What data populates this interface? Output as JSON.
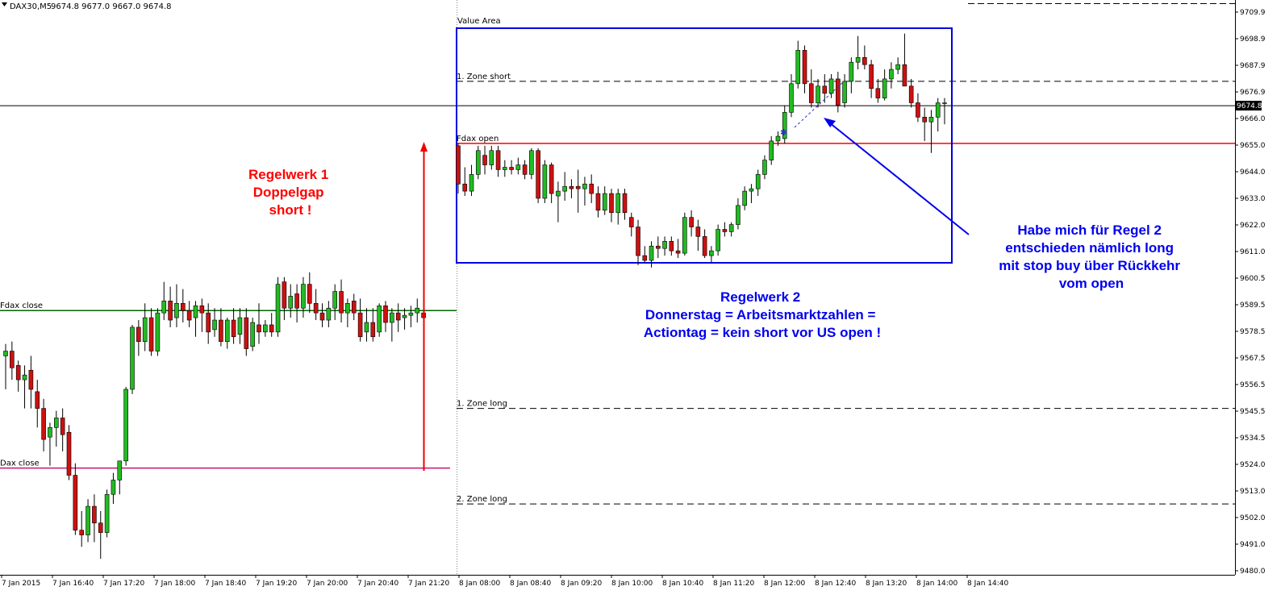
{
  "header": {
    "symbol": "DAX30,M5",
    "ohlc": "9674.8 9677.0 9667.0 9674.8"
  },
  "colors": {
    "bull_body": "#22bb22",
    "bear_body": "#cc1111",
    "wick": "#000000",
    "fdax_close_line": "#006600",
    "dax_close_line": "#cc1177",
    "fdax_open_line": "#ff0000",
    "value_area_box": "#0000dd",
    "annotation_red": "#ff0000",
    "annotation_blue": "#0000ee"
  },
  "chart_data": {
    "type": "candlestick",
    "ylim": [
      9480,
      9714
    ],
    "y_ticks": [
      "9709.9",
      "9698.9",
      "9687.9",
      "9676.9",
      "9666.0",
      "9655.0",
      "9644.0",
      "9633.0",
      "9622.0",
      "9611.0",
      "9600.5",
      "9589.5",
      "9578.5",
      "9567.5",
      "9556.5",
      "9545.5",
      "9534.5",
      "9524.0",
      "9513.0",
      "9502.0",
      "9491.0",
      "9480.0"
    ],
    "x_ticks": [
      "7 Jan 2015",
      "7 Jan 16:40",
      "7 Jan 17:20",
      "7 Jan 18:00",
      "7 Jan 18:40",
      "7 Jan 19:20",
      "7 Jan 20:00",
      "7 Jan 20:40",
      "7 Jan 21:20",
      "8 Jan 08:00",
      "8 Jan 08:40",
      "8 Jan 09:20",
      "8 Jan 10:00",
      "8 Jan 10:40",
      "8 Jan 11:20",
      "8 Jan 12:00",
      "8 Jan 12:40",
      "8 Jan 13:20",
      "8 Jan 14:00",
      "8 Jan 14:40"
    ],
    "current_price": "9674.8",
    "session1_ohlc": [
      [
        9570,
        9575,
        9556,
        9572
      ],
      [
        9572,
        9576,
        9560,
        9565
      ],
      [
        9566,
        9568,
        9555,
        9560
      ],
      [
        9560,
        9566,
        9548,
        9562
      ],
      [
        9564,
        9570,
        9548,
        9556
      ],
      [
        9555,
        9560,
        9540,
        9548
      ],
      [
        9548,
        9552,
        9530,
        9535
      ],
      [
        9536,
        9542,
        9524,
        9540
      ],
      [
        9540,
        9547,
        9532,
        9544
      ],
      [
        9544,
        9548,
        9530,
        9537
      ],
      [
        9538,
        9541,
        9518,
        9520
      ],
      [
        9520,
        9525,
        9495,
        9497
      ],
      [
        9497,
        9505,
        9490,
        9495
      ],
      [
        9495,
        9510,
        9492,
        9507
      ],
      [
        9507,
        9512,
        9492,
        9500
      ],
      [
        9500,
        9505,
        9485,
        9496
      ],
      [
        9496,
        9514,
        9494,
        9512
      ],
      [
        9512,
        9521,
        9508,
        9518
      ],
      [
        9518,
        9526,
        9512,
        9526
      ],
      [
        9526,
        9557,
        9524,
        9556
      ],
      [
        9556,
        9583,
        9554,
        9582
      ],
      [
        9582,
        9585,
        9570,
        9576
      ],
      [
        9576,
        9592,
        9572,
        9586
      ],
      [
        9586,
        9590,
        9570,
        9572
      ],
      [
        9572,
        9590,
        9570,
        9588
      ],
      [
        9588,
        9601,
        9585,
        9593
      ],
      [
        9593,
        9599,
        9582,
        9585
      ],
      [
        9586,
        9600,
        9582,
        9592
      ],
      [
        9592,
        9598,
        9584,
        9589
      ],
      [
        9589,
        9593,
        9582,
        9585
      ],
      [
        9586,
        9593,
        9578,
        9591
      ],
      [
        9591,
        9594,
        9580,
        9588
      ],
      [
        9588,
        9592,
        9575,
        9580
      ],
      [
        9581,
        9590,
        9578,
        9585
      ],
      [
        9585,
        9590,
        9574,
        9576
      ],
      [
        9576,
        9586,
        9573,
        9585
      ],
      [
        9585,
        9590,
        9575,
        9578
      ],
      [
        9579,
        9590,
        9575,
        9586
      ],
      [
        9586,
        9590,
        9570,
        9573
      ],
      [
        9574,
        9586,
        9572,
        9584
      ],
      [
        9583,
        9592,
        9575,
        9580
      ],
      [
        9580,
        9585,
        9578,
        9583
      ],
      [
        9583,
        9588,
        9578,
        9580
      ],
      [
        9580,
        9603,
        9578,
        9600
      ],
      [
        9601,
        9603,
        9585,
        9590
      ],
      [
        9590,
        9600,
        9586,
        9595
      ],
      [
        9596,
        9600,
        9584,
        9590
      ],
      [
        9590,
        9603,
        9586,
        9600
      ],
      [
        9600,
        9605,
        9588,
        9592
      ],
      [
        9592,
        9598,
        9585,
        9588
      ],
      [
        9588,
        9592,
        9582,
        9585
      ],
      [
        9585,
        9593,
        9582,
        9590
      ],
      [
        9590,
        9600,
        9585,
        9597
      ],
      [
        9597,
        9602,
        9584,
        9588
      ],
      [
        9588,
        9594,
        9582,
        9592
      ],
      [
        9593,
        9596,
        9585,
        9588
      ],
      [
        9588,
        9594,
        9576,
        9578
      ],
      [
        9580,
        9590,
        9576,
        9584
      ],
      [
        9584,
        9590,
        9576,
        9578
      ],
      [
        9580,
        9592,
        9578,
        9591
      ],
      [
        9591,
        9593,
        9580,
        9584
      ],
      [
        9584,
        9590,
        9576,
        9588
      ],
      [
        9588,
        9592,
        9580,
        9585
      ],
      [
        9586,
        9590,
        9581,
        9587
      ],
      [
        9587,
        9591,
        9582,
        9588
      ],
      [
        9588,
        9594,
        9584,
        9590
      ],
      [
        9588,
        9592,
        9584,
        9586
      ]
    ],
    "session2_ohlc": [
      [
        9658,
        9659,
        9638,
        9642
      ],
      [
        9642,
        9649,
        9637,
        9639
      ],
      [
        9639,
        9650,
        9637,
        9646
      ],
      [
        9646,
        9658,
        9644,
        9656
      ],
      [
        9654,
        9658,
        9646,
        9650
      ],
      [
        9650,
        9658,
        9648,
        9656
      ],
      [
        9656,
        9658,
        9645,
        9648
      ],
      [
        9648,
        9652,
        9645,
        9649
      ],
      [
        9649,
        9652,
        9646,
        9648
      ],
      [
        9648,
        9653,
        9646,
        9650
      ],
      [
        9650,
        9652,
        9644,
        9646
      ],
      [
        9646,
        9657,
        9644,
        9656
      ],
      [
        9656,
        9657,
        9634,
        9636
      ],
      [
        9636,
        9652,
        9634,
        9650
      ],
      [
        9650,
        9651,
        9634,
        9638
      ],
      [
        9637,
        9643,
        9626,
        9639
      ],
      [
        9639,
        9647,
        9635,
        9641
      ],
      [
        9641,
        9644,
        9636,
        9640
      ],
      [
        9641,
        9648,
        9630,
        9640
      ],
      [
        9640,
        9645,
        9633,
        9642
      ],
      [
        9642,
        9646,
        9634,
        9638
      ],
      [
        9638,
        9641,
        9628,
        9631
      ],
      [
        9631,
        9641,
        9629,
        9638
      ],
      [
        9638,
        9640,
        9626,
        9630
      ],
      [
        9630,
        9640,
        9625,
        9638
      ],
      [
        9638,
        9640,
        9627,
        9630
      ],
      [
        9628,
        9630,
        9620,
        9624
      ],
      [
        9624,
        9627,
        9608,
        9612
      ],
      [
        9612,
        9616,
        9609,
        9610
      ],
      [
        9610,
        9618,
        9607,
        9616
      ],
      [
        9616,
        9620,
        9611,
        9615
      ],
      [
        9615,
        9620,
        9612,
        9618
      ],
      [
        9618,
        9620,
        9612,
        9614
      ],
      [
        9614,
        9619,
        9611,
        9613
      ],
      [
        9613,
        9630,
        9612,
        9628
      ],
      [
        9628,
        9631,
        9620,
        9624
      ],
      [
        9624,
        9627,
        9614,
        9620
      ],
      [
        9620,
        9623,
        9611,
        9612
      ],
      [
        9612,
        9616,
        9609,
        9614
      ],
      [
        9614,
        9625,
        9612,
        9623
      ],
      [
        9623,
        9626,
        9620,
        9622
      ],
      [
        9622,
        9626,
        9620,
        9625
      ],
      [
        9625,
        9636,
        9623,
        9633
      ],
      [
        9633,
        9641,
        9631,
        9639
      ],
      [
        9639,
        9642,
        9634,
        9640
      ],
      [
        9640,
        9648,
        9637,
        9646
      ],
      [
        9646,
        9654,
        9644,
        9652
      ],
      [
        9652,
        9662,
        9650,
        9660
      ],
      [
        9660,
        9664,
        9658,
        9662
      ],
      [
        9661,
        9675,
        9659,
        9672
      ],
      [
        9672,
        9688,
        9670,
        9684
      ],
      [
        9684,
        9702,
        9682,
        9698
      ],
      [
        9698,
        9700,
        9680,
        9684
      ],
      [
        9684,
        9690,
        9674,
        9676
      ],
      [
        9676,
        9686,
        9674,
        9683
      ],
      [
        9683,
        9688,
        9676,
        9680
      ],
      [
        9680,
        9688,
        9678,
        9686
      ],
      [
        9686,
        9689,
        9672,
        9675
      ],
      [
        9676,
        9688,
        9674,
        9685
      ],
      [
        9685,
        9695,
        9680,
        9693
      ],
      [
        9693,
        9704,
        9690,
        9695
      ],
      [
        9695,
        9700,
        9690,
        9692
      ],
      [
        9692,
        9694,
        9678,
        9682
      ],
      [
        9682,
        9686,
        9676,
        9678
      ],
      [
        9678,
        9690,
        9677,
        9686
      ],
      [
        9686,
        9693,
        9682,
        9690
      ],
      [
        9690,
        9695,
        9688,
        9692
      ],
      [
        9692,
        9705,
        9690,
        9683
      ],
      [
        9683,
        9686,
        9674,
        9676
      ],
      [
        9676,
        9680,
        9668,
        9670
      ],
      [
        9670,
        9674,
        9660,
        9668
      ],
      [
        9668,
        9673,
        9655,
        9670
      ],
      [
        9670,
        9678,
        9664,
        9676
      ],
      [
        9676,
        9678,
        9667,
        9676
      ]
    ],
    "levels": [
      {
        "label": "Fdax close",
        "value": 9589
      },
      {
        "label": "Dax close",
        "value": 9523
      },
      {
        "label": "Fdax open",
        "value": 9659
      },
      {
        "label": "1. Zone short",
        "value": 9685
      },
      {
        "label": "1. Zone long",
        "value": 9548
      },
      {
        "label": "2. Zone long",
        "value": 9508
      }
    ],
    "value_area_label": "Value Area"
  },
  "annotations": {
    "regelwerk1": [
      "Regelwerk 1",
      "Doppelgap",
      "short !"
    ],
    "regelwerk2": [
      "Regelwerk 2",
      "Donnerstag = Arbeitsmarktzahlen =",
      "Actiontag = kein short vor US open !"
    ],
    "regel2_note": [
      "Habe mich für Regel 2",
      "entschieden nämlich long",
      "mit stop buy über Rückkehr",
      "vom open"
    ]
  }
}
